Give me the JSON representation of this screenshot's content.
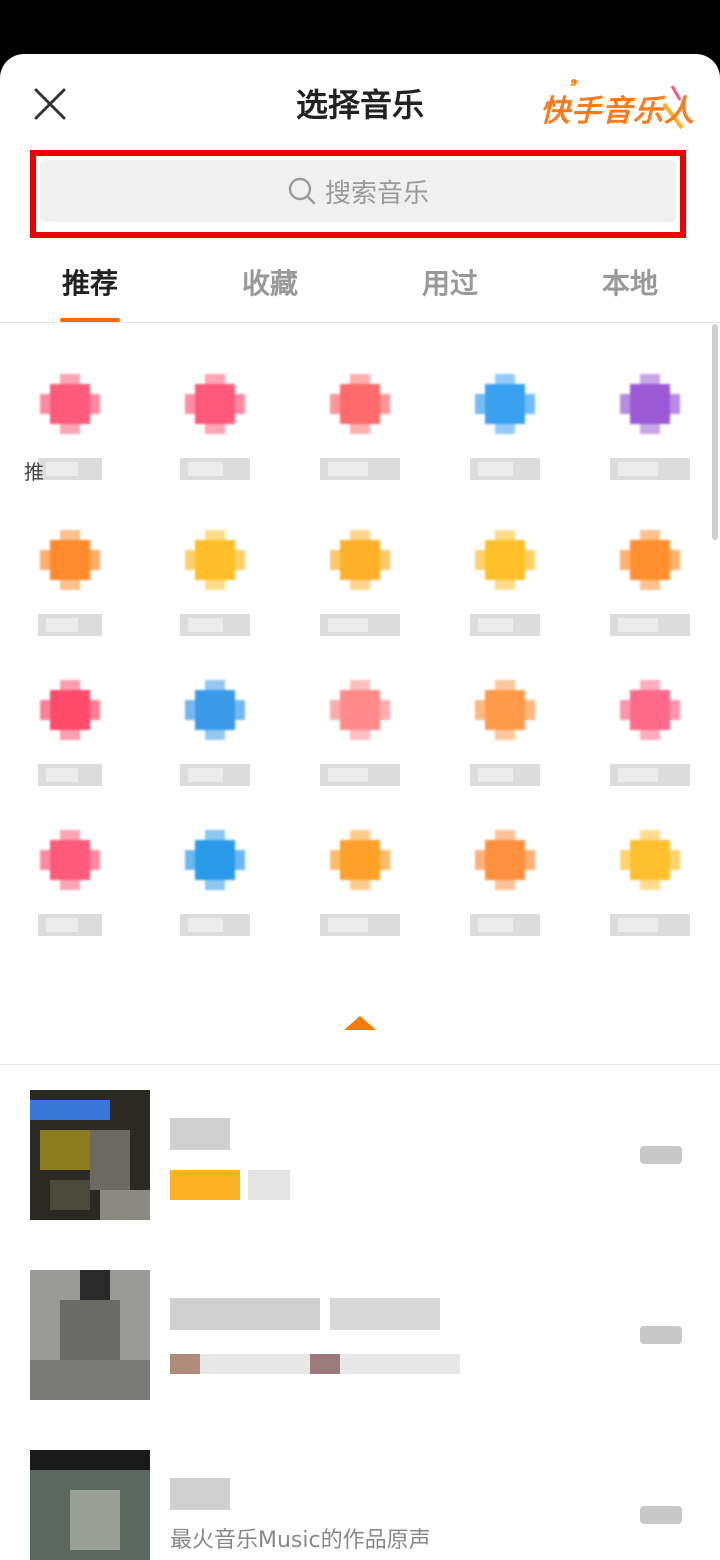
{
  "header": {
    "title": "选择音乐",
    "brand": "快手音乐人",
    "close_icon": "close-icon"
  },
  "search": {
    "placeholder": "搜索音乐",
    "icon": "search-icon",
    "highlight_color": "#ee0000"
  },
  "tabs": [
    {
      "label": "推荐",
      "active": true
    },
    {
      "label": "收藏",
      "active": false
    },
    {
      "label": "用过",
      "active": false
    },
    {
      "label": "本地",
      "active": false
    }
  ],
  "categories": [
    {
      "icon": "category-icon",
      "color": "#ff5a7a",
      "label_prefix": "推"
    },
    {
      "icon": "category-icon",
      "color": "#ff5a7a",
      "label_prefix": ""
    },
    {
      "icon": "category-icon",
      "color": "#ff6a6a",
      "label_prefix": ""
    },
    {
      "icon": "category-icon",
      "color": "#3aa0f0",
      "label_prefix": ""
    },
    {
      "icon": "category-icon",
      "color": "#9a5ad6",
      "label_prefix": ""
    },
    {
      "icon": "category-icon",
      "color": "#ff8a2a",
      "label_prefix": ""
    },
    {
      "icon": "category-icon",
      "color": "#ffbe2a",
      "label_prefix": ""
    },
    {
      "icon": "category-icon",
      "color": "#ffb02a",
      "label_prefix": ""
    },
    {
      "icon": "category-icon",
      "color": "#ffc02a",
      "label_prefix": ""
    },
    {
      "icon": "category-icon",
      "color": "#ff9030",
      "label_prefix": ""
    },
    {
      "icon": "category-icon",
      "color": "#ff4a6a",
      "label_prefix": ""
    },
    {
      "icon": "category-icon",
      "color": "#3a9ae8",
      "label_prefix": ""
    },
    {
      "icon": "category-icon",
      "color": "#ff8a8a",
      "label_prefix": ""
    },
    {
      "icon": "category-icon",
      "color": "#ff9a4a",
      "label_prefix": ""
    },
    {
      "icon": "category-icon",
      "color": "#ff6a8a",
      "label_prefix": ""
    },
    {
      "icon": "category-icon",
      "color": "#ff5a7a",
      "label_prefix": ""
    },
    {
      "icon": "category-icon",
      "color": "#2a9ae8",
      "label_prefix": ""
    },
    {
      "icon": "category-icon",
      "color": "#ffa02a",
      "label_prefix": ""
    },
    {
      "icon": "category-icon",
      "color": "#ff9040",
      "label_prefix": ""
    },
    {
      "icon": "category-icon",
      "color": "#ffc030",
      "label_prefix": ""
    }
  ],
  "collapse_icon": "chevron-up-icon",
  "songs": [
    {
      "title": "",
      "subtitle": "",
      "cover": "album-cover",
      "action_icon": "use-music-icon"
    },
    {
      "title": "",
      "subtitle": "",
      "cover": "album-cover",
      "action_icon": "use-music-icon"
    },
    {
      "title": "",
      "subtitle": "最火音乐Music的作品原声",
      "cover": "album-cover",
      "action_icon": "use-music-icon"
    }
  ],
  "colors": {
    "accent": "#ff6a00",
    "brand": "#ff7a1a"
  }
}
